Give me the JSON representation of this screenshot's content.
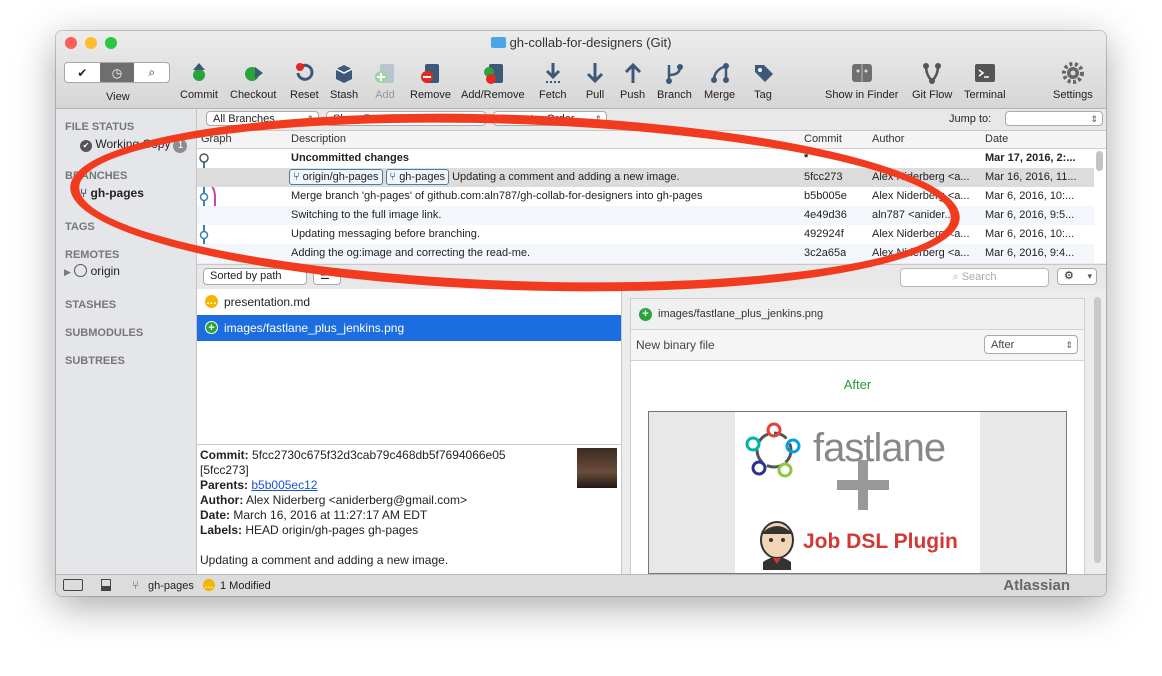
{
  "window": {
    "title": "gh-collab-for-designers (Git)"
  },
  "toolbar": {
    "view_label": "View",
    "items": [
      {
        "label": "Commit"
      },
      {
        "label": "Checkout"
      },
      {
        "label": "Reset"
      },
      {
        "label": "Stash"
      },
      {
        "label": "Add"
      },
      {
        "label": "Remove"
      },
      {
        "label": "Add/Remove"
      },
      {
        "label": "Fetch"
      },
      {
        "label": "Pull"
      },
      {
        "label": "Push"
      },
      {
        "label": "Branch"
      },
      {
        "label": "Merge"
      },
      {
        "label": "Tag"
      }
    ],
    "right_items": [
      {
        "label": "Show in Finder"
      },
      {
        "label": "Git Flow"
      },
      {
        "label": "Terminal"
      },
      {
        "label": "Settings"
      }
    ]
  },
  "sidebar": {
    "file_status": "FILE STATUS",
    "working_copy": "Working Copy",
    "working_copy_count": "1",
    "branches": "BRANCHES",
    "current_branch": "gh-pages",
    "tags": "TAGS",
    "remotes": "REMOTES",
    "remote_origin": "origin",
    "stashes": "STASHES",
    "submodules": "SUBMODULES",
    "subtrees": "SUBTREES"
  },
  "filterbar": {
    "branches": "All Branches",
    "remote": "Show Remote Branches",
    "order": "Ancestor Order",
    "jump_to": "Jump to:"
  },
  "commits": {
    "headers": {
      "graph": "Graph",
      "description": "Description",
      "commit": "Commit",
      "author": "Author",
      "date": "Date"
    },
    "rows": [
      {
        "description": "Uncommitted changes",
        "commit": "*",
        "author": "",
        "date": "Mar 17, 2016, 2:..."
      },
      {
        "tag1": "origin/gh-pages",
        "tag2": "gh-pages",
        "description": "Updating a comment and adding a new image.",
        "commit": "5fcc273",
        "author": "Alex Niderberg <a...",
        "date": "Mar 16, 2016, 11..."
      },
      {
        "description": "Merge branch 'gh-pages' of github.com:aln787/gh-collab-for-designers into gh-pages",
        "commit": "b5b005e",
        "author": "Alex Niderberg <a...",
        "date": "Mar 6, 2016, 10:..."
      },
      {
        "description": "Switching to the full image link.",
        "commit": "4e49d36",
        "author": "aln787 <anider...",
        "date": "Mar 6, 2016, 9:5..."
      },
      {
        "description": "Updating messaging before branching.",
        "commit": "492924f",
        "author": "Alex Niderberg <a...",
        "date": "Mar 6, 2016, 10:..."
      },
      {
        "description": "Adding the og:image and correcting the read-me.",
        "commit": "3c2a65a",
        "author": "Alex Niderberg <a...",
        "date": "Mar 6, 2016, 9:4..."
      }
    ]
  },
  "lower": {
    "sort_label": "Sorted by path",
    "search_placeholder": "Search"
  },
  "files": [
    {
      "name": "presentation.md",
      "status": "modified"
    },
    {
      "name": "images/fastlane_plus_jenkins.png",
      "status": "added"
    }
  ],
  "details": {
    "commit_label": "Commit:",
    "commit_value": "5fcc2730c675f32d3cab79c468db5f7694066e05",
    "short_hash": "[5fcc273]",
    "parents_label": "Parents:",
    "parents_value": "b5b005ec12",
    "author_label": "Author:",
    "author_value": "Alex Niderberg <aniderberg@gmail.com>",
    "date_label": "Date:",
    "date_value": "March 16, 2016 at 11:27:17 AM EDT",
    "labels_label": "Labels:",
    "labels_value": "HEAD origin/gh-pages gh-pages",
    "message": "Updating a comment and adding a new image."
  },
  "diff": {
    "file": "images/fastlane_plus_jenkins.png",
    "info": "New binary file",
    "mode": "After",
    "heading": "After",
    "image_text_fastlane": "fastlane",
    "image_text_plugin": "Job DSL Plugin"
  },
  "statusbar": {
    "branch": "gh-pages",
    "modified": "1 Modified",
    "brand": "Atlassian"
  },
  "colors": {
    "accent": "#1c6ee0",
    "annotation": "#f23a1e",
    "added": "#2aa33a",
    "modified": "#f5b400"
  }
}
